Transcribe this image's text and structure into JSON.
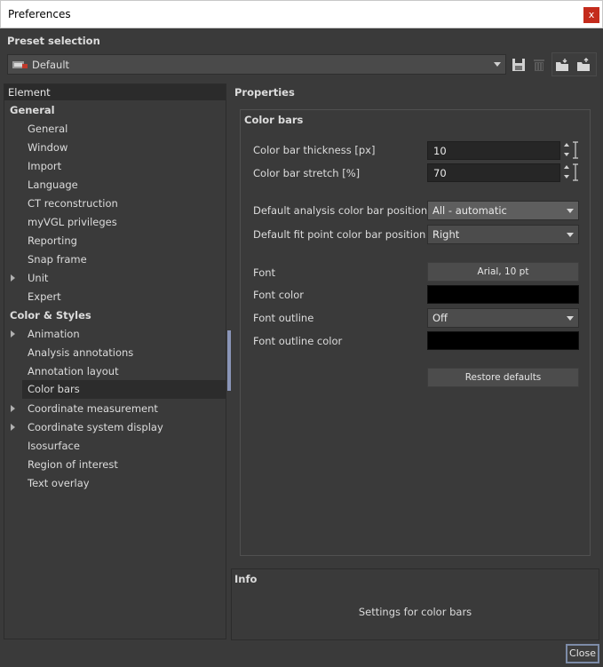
{
  "window": {
    "title": "Preferences",
    "close_glyph": "x"
  },
  "preset": {
    "label": "Preset selection",
    "value": "Default",
    "tools": [
      "save-icon",
      "delete-icon",
      "import-folder-icon",
      "export-folder-icon"
    ]
  },
  "tree": {
    "header": "Element",
    "items": [
      {
        "label": "General",
        "kind": "category"
      },
      {
        "label": "General",
        "kind": "child"
      },
      {
        "label": "Window",
        "kind": "child"
      },
      {
        "label": "Import",
        "kind": "child"
      },
      {
        "label": "Language",
        "kind": "child"
      },
      {
        "label": "CT reconstruction",
        "kind": "child"
      },
      {
        "label": "myVGL privileges",
        "kind": "child"
      },
      {
        "label": "Reporting",
        "kind": "child"
      },
      {
        "label": "Snap frame",
        "kind": "child"
      },
      {
        "label": "Unit",
        "kind": "child",
        "expandable": true
      },
      {
        "label": "Expert",
        "kind": "child"
      },
      {
        "label": "Color & Styles",
        "kind": "category"
      },
      {
        "label": "Animation",
        "kind": "child",
        "expandable": true
      },
      {
        "label": "Analysis annotations",
        "kind": "child"
      },
      {
        "label": "Annotation layout",
        "kind": "child"
      },
      {
        "label": "Color bars",
        "kind": "child",
        "selected": true
      },
      {
        "label": "Coordinate measurement",
        "kind": "child",
        "expandable": true
      },
      {
        "label": "Coordinate system display",
        "kind": "child",
        "expandable": true
      },
      {
        "label": "Isosurface",
        "kind": "child"
      },
      {
        "label": "Region of interest",
        "kind": "child"
      },
      {
        "label": "Text overlay",
        "kind": "child"
      }
    ]
  },
  "properties": {
    "title": "Properties",
    "group_title": "Color bars",
    "thickness_label": "Color bar thickness [px]",
    "thickness_value": "10",
    "stretch_label": "Color bar stretch [%]",
    "stretch_value": "70",
    "analysis_pos_label": "Default analysis color bar position",
    "analysis_pos_value": "All - automatic",
    "fit_pos_label": "Default fit point color bar position",
    "fit_pos_value": "Right",
    "font_label": "Font",
    "font_value": "Arial, 10 pt",
    "font_color_label": "Font color",
    "font_color_value": "#000000",
    "outline_label": "Font outline",
    "outline_value": "Off",
    "outline_color_label": "Font outline color",
    "outline_color_value": "#000000",
    "restore_label": "Restore defaults"
  },
  "info": {
    "title": "Info",
    "text": "Settings for color bars"
  },
  "footer": {
    "close_label": "Close"
  }
}
